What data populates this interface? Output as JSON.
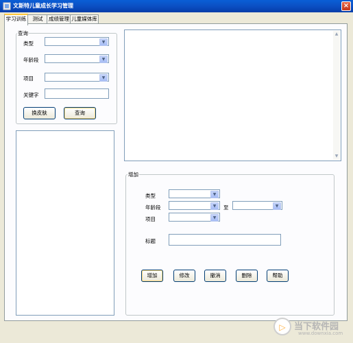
{
  "window": {
    "title": "文斯特儿童成长学习管理",
    "close_icon": "×"
  },
  "tabs": [
    {
      "label": "学习训练",
      "active": true
    },
    {
      "label": "测试",
      "active": false
    },
    {
      "label": "成绩管理",
      "active": false
    },
    {
      "label": "儿童媒体库",
      "active": false
    }
  ],
  "query": {
    "legend": "查询",
    "type_label": "类型",
    "age_label": "年龄段",
    "item_label": "项目",
    "keyword_label": "关键字",
    "skin_button": "换皮肤",
    "query_button": "查询"
  },
  "add": {
    "legend": "增加",
    "type_label": "类型",
    "age_label": "年龄段",
    "to_label": "至",
    "item_label": "项目",
    "title_label": "标题",
    "buttons": {
      "add": "增加",
      "edit": "修改",
      "cancel": "撤消",
      "delete": "删除",
      "help": "帮助"
    }
  },
  "watermark": {
    "text": "当下软件园",
    "url": "www.downxia.com"
  },
  "colors": {
    "titlebar": "#0b4fc3",
    "tab_highlight": "#ffc83c",
    "window_bg": "#ece9d8"
  }
}
